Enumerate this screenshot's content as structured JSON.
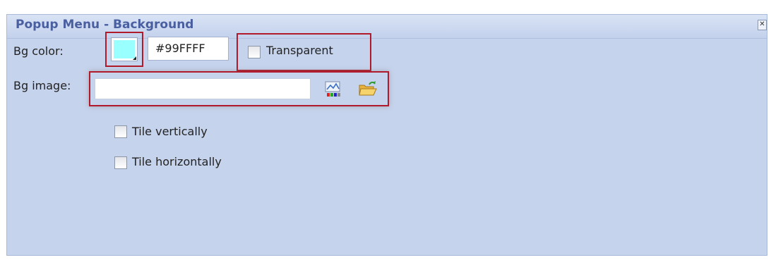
{
  "panel": {
    "title": "Popup Menu - Background",
    "close_glyph": "✕"
  },
  "bg_color": {
    "label": "Bg color:",
    "swatch_color": "#99FFFF",
    "hex_value": "#99FFFF",
    "transparent_label": "Transparent",
    "transparent_checked": false
  },
  "bg_image": {
    "label": "Bg image:",
    "value": "",
    "preview_icon": "image-preview-icon",
    "browse_icon": "open-folder-icon"
  },
  "tile": {
    "vertical_label": "Tile vertically",
    "vertical_checked": false,
    "horizontal_label": "Tile horizontally",
    "horizontal_checked": false
  },
  "colors": {
    "panel_bg": "#c6d3ec",
    "title_text": "#4a5fa0",
    "highlight_border": "#b01a2a"
  }
}
